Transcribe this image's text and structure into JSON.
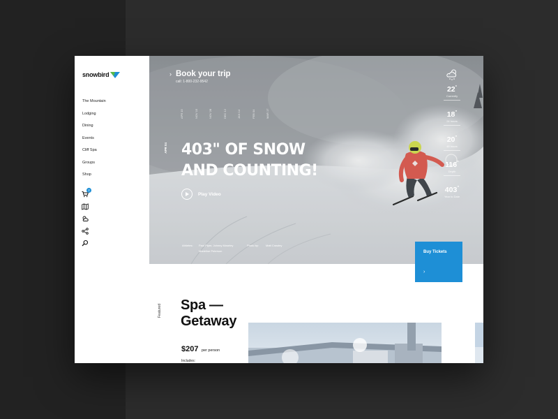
{
  "brand": {
    "name": "snowbird",
    "accent": "#1e8fd6",
    "logo_green": "#5ab946"
  },
  "nav": {
    "items": [
      "The Mountain",
      "Lodging",
      "Dining",
      "Events",
      "Cliff Spa",
      "Groups",
      "Shop"
    ]
  },
  "side_icons": [
    {
      "name": "cart-icon",
      "badge": "2"
    },
    {
      "name": "map-icon"
    },
    {
      "name": "weather-icon"
    },
    {
      "name": "share-icon"
    },
    {
      "name": "search-icon"
    }
  ],
  "hero": {
    "book_title": "Book your trip",
    "book_phone": "call: 1-800-232-9542",
    "timeline": [
      "APR 15",
      "NOV 15",
      "NOV 28",
      "DEC 12",
      "JAN 14",
      "FEB 04",
      "MAR 17"
    ],
    "date_tag": "APR 04",
    "headline_line1": "403\" OF SNOW",
    "headline_line2": "AND COUNTING!",
    "play_label": "Play Video",
    "credits": {
      "athletes_label": "Athletes:",
      "athletes": "Paul Piper, Johnny Moseley",
      "athletes2": "Madeline Peterson",
      "photo_label": "Photo by:",
      "photo_by": "Matt Crawley"
    }
  },
  "weather": [
    {
      "value": "22",
      "unit": "°",
      "label": "Currently"
    },
    {
      "value": "18",
      "unit": "\"",
      "label": "24 hours"
    },
    {
      "value": "20",
      "unit": "\"",
      "label": "48 hours"
    },
    {
      "value": "116",
      "unit": "\"",
      "label": "Depth"
    },
    {
      "value": "403",
      "unit": "\"",
      "label": "Year to Date"
    }
  ],
  "buy": {
    "label": "Buy Tickets",
    "arrow": "›"
  },
  "featured": {
    "tag": "Featured",
    "title_line1": "Spa —",
    "title_line2": "Getaway",
    "price": "$207",
    "price_unit": "per person",
    "includes": "Includes:"
  }
}
